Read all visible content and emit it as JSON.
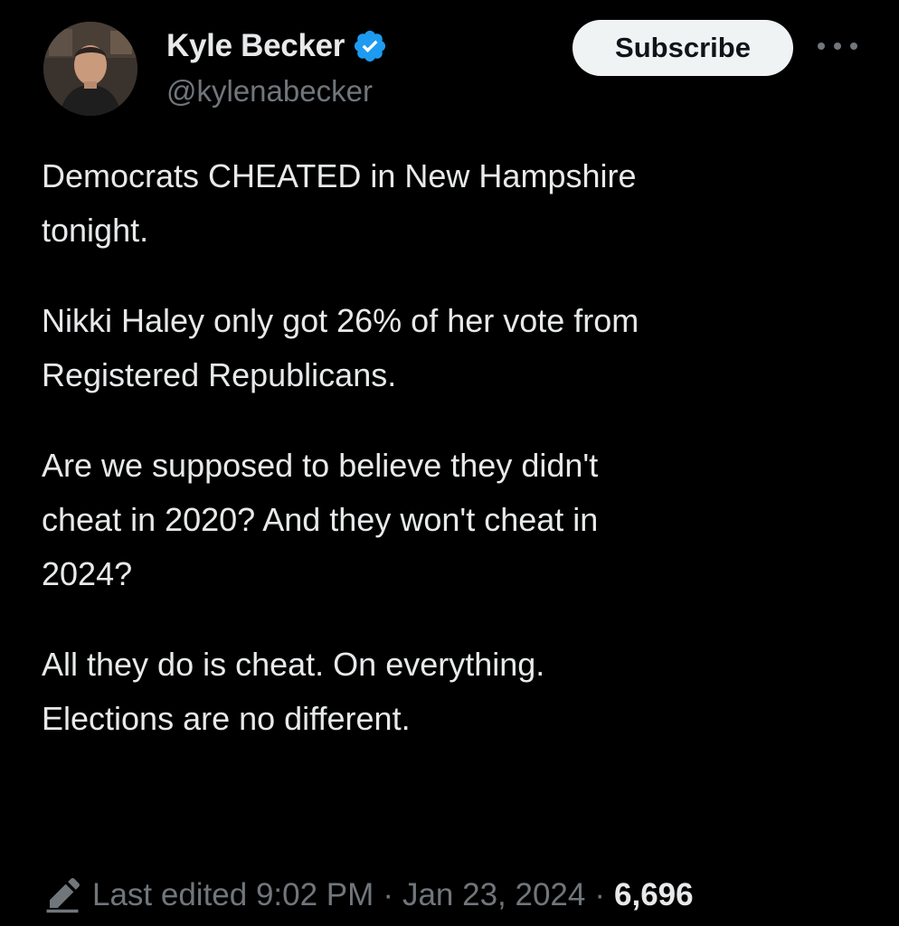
{
  "author": {
    "display_name": "Kyle Becker",
    "handle": "@kylenabecker",
    "verified_icon": "verified-badge-icon",
    "verified_color": "#1d9bf0"
  },
  "actions": {
    "subscribe_label": "Subscribe",
    "more_icon": "more-options-icon"
  },
  "tweet": {
    "paragraphs": [
      "Democrats CHEATED in New Hampshire\ntonight.",
      "Nikki Haley only got 26% of her vote from\nRegistered Republicans.",
      "Are we supposed to believe they didn't\ncheat in 2020? And they won't cheat in\n2024?",
      "All they do is cheat. On everything.\nElections are no different."
    ]
  },
  "footer": {
    "edit_icon": "pencil-edit-icon",
    "edited_label": "Last edited 9:02 PM",
    "separator": "·",
    "date": "Jan 23, 2024",
    "views": "6,696"
  },
  "colors": {
    "background": "#000000",
    "text": "#e7e9ea",
    "muted": "#71767b",
    "button_bg": "#eff3f4"
  }
}
